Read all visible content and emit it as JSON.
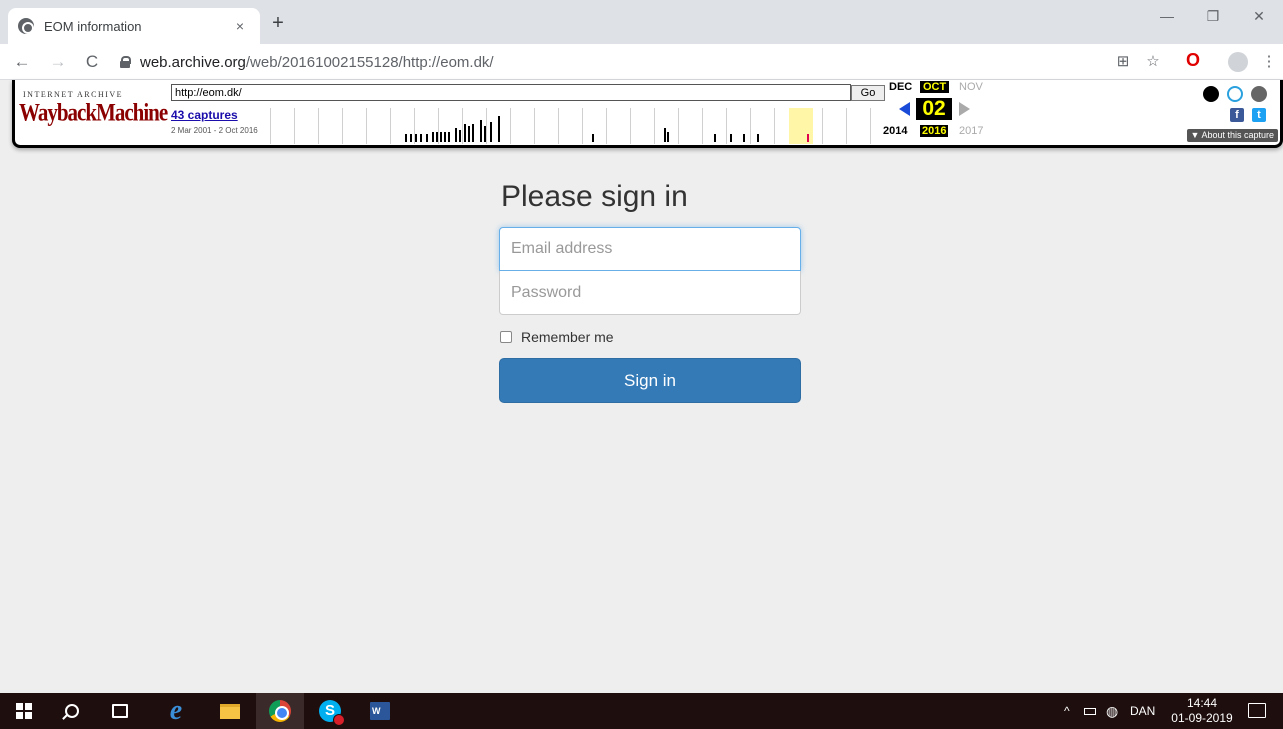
{
  "browser": {
    "tab_title": "EOM information",
    "tab_close": "×",
    "new_tab": "+",
    "window_minimize": "—",
    "window_restore": "❐",
    "window_close": "✕",
    "nav_back": "←",
    "nav_forward": "→",
    "nav_reload": "C",
    "url_domain": "web.archive.org",
    "url_path": "/web/20161002155128/http://eom.dk/",
    "translate_icon": "⊞",
    "star_icon": "☆",
    "opera_icon": "O",
    "menu_icon": "⋮"
  },
  "wayback": {
    "ia_label": "INTERNET ARCHIVE",
    "logo_text": "WaybackMachine",
    "url_value": "http://eom.dk/",
    "go_label": "Go",
    "captures_label": "43 captures",
    "date_range": "2 Mar 2001 - 2 Oct 2016",
    "prev_month": "DEC",
    "current_month": "OCT",
    "next_month": "NOV",
    "current_day": "02",
    "prev_year": "2014",
    "current_year": "2016",
    "next_year": "2017",
    "about_label": "▼ About this capture",
    "facebook_label": "f",
    "twitter_label": "t",
    "colors": {
      "highlight": "#fff6a8",
      "current_capture": "#e0004d",
      "bar": "#000000",
      "year_tick": "#d0d0d0"
    }
  },
  "page": {
    "heading": "Please sign in",
    "email_placeholder": "Email address",
    "password_placeholder": "Password",
    "remember_label": "Remember me",
    "signin_label": "Sign in",
    "colors": {
      "button": "#337ab7",
      "focus": "#66afe9"
    }
  },
  "taskbar": {
    "tray_chevron": "^",
    "tray_network": "◍",
    "language": "DAN",
    "time": "14:44",
    "date": "01-09-2019",
    "word_label": "W",
    "skype_label": "S",
    "ie_label": "e"
  }
}
